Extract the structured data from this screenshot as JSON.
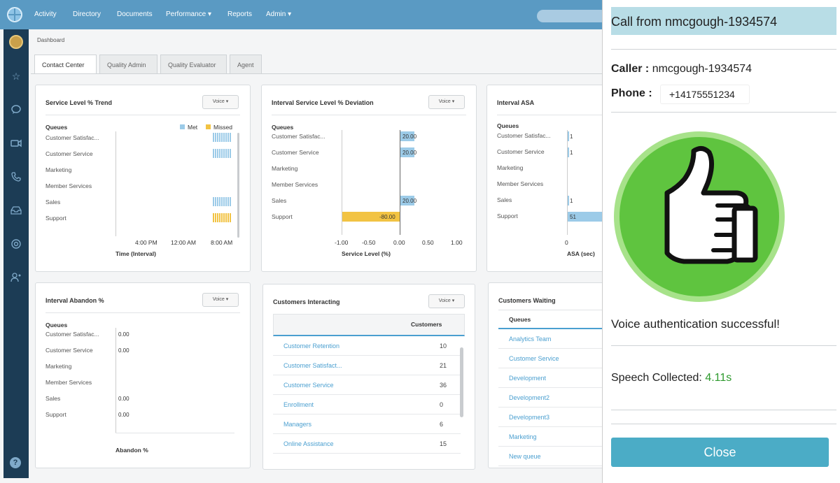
{
  "nav": {
    "items": [
      "Activity",
      "Directory",
      "Documents",
      "Performance ▾",
      "Reports",
      "Admin ▾"
    ]
  },
  "breadcrumb": "Dashboard",
  "tabs": [
    "Contact Center",
    "Quality Admin",
    "Quality Evaluator",
    "Agent"
  ],
  "voice_label": "Voice ▾",
  "queues_header": "Queues",
  "panels": {
    "service_level_trend": {
      "title": "Service Level % Trend",
      "legend_met": "Met",
      "legend_missed": "Missed",
      "queues": [
        "Customer Satisfac...",
        "Customer Service",
        "Marketing",
        "Member Services",
        "Sales",
        "Support"
      ],
      "x_ticks": [
        "4:00 PM",
        "12:00 AM",
        "8:00 AM"
      ],
      "xlabel": "Time (Interval)"
    },
    "interval_deviation": {
      "title": "Interval Service Level % Deviation",
      "queues": [
        "Customer Satisfac...",
        "Customer Service",
        "Marketing",
        "Member Services",
        "Sales",
        "Support"
      ],
      "values": [
        "20.00",
        "20.00",
        "",
        "",
        "20.00",
        "-80.00"
      ],
      "x_ticks": [
        "-1.00",
        "-0.50",
        "0.00",
        "0.50",
        "1.00"
      ],
      "xlabel": "Service Level (%)"
    },
    "interval_asa": {
      "title": "Interval ASA",
      "queues": [
        "Customer Satisfac...",
        "Customer Service",
        "Marketing",
        "Member Services",
        "Sales",
        "Support"
      ],
      "values": [
        "1",
        "1",
        "",
        "",
        "1",
        "51"
      ],
      "x_tick": "0",
      "xlabel": "ASA (sec)"
    },
    "interval_abandon": {
      "title": "Interval Abandon %",
      "queues": [
        "Customer Satisfac...",
        "Customer Service",
        "Marketing",
        "Member Services",
        "Sales",
        "Support"
      ],
      "values": [
        "0.00",
        "0.00",
        "",
        "",
        "0.00",
        "0.00"
      ],
      "xlabel": "Abandon %"
    },
    "customers_interacting": {
      "title": "Customers Interacting",
      "col_header": "Customers",
      "rows": [
        {
          "name": "Customer Retention",
          "count": "10"
        },
        {
          "name": "Customer Satisfact...",
          "count": "21"
        },
        {
          "name": "Customer Service",
          "count": "36"
        },
        {
          "name": "Enrollment",
          "count": "0"
        },
        {
          "name": "Managers",
          "count": "6"
        },
        {
          "name": "Online Assistance",
          "count": "15"
        }
      ]
    },
    "customers_waiting": {
      "title": "Customers Waiting",
      "col_header": "Queues",
      "rows": [
        "Analytics Team",
        "Customer Service",
        "Development",
        "Development2",
        "Development3",
        "Marketing",
        "New queue"
      ]
    }
  },
  "chart_data": [
    {
      "type": "bar",
      "title": "Interval Service Level % Deviation",
      "categories": [
        "Customer Satisfac...",
        "Customer Service",
        "Marketing",
        "Member Services",
        "Sales",
        "Support"
      ],
      "values": [
        20.0,
        20.0,
        null,
        null,
        20.0,
        -80.0
      ],
      "xlabel": "Service Level (%)",
      "xlim": [
        -1.0,
        1.0
      ],
      "colors": {
        "positive": "#9ccbe8",
        "negative": "#f2c343"
      }
    },
    {
      "type": "bar",
      "title": "Interval ASA",
      "categories": [
        "Customer Satisfac...",
        "Customer Service",
        "Marketing",
        "Member Services",
        "Sales",
        "Support"
      ],
      "values": [
        1,
        1,
        null,
        null,
        1,
        51
      ],
      "xlabel": "ASA (sec)"
    }
  ],
  "popup": {
    "title": "Call from nmcgough-1934574",
    "caller_label": "Caller :",
    "caller_value": "nmcgough-1934574",
    "phone_label": "Phone :",
    "phone_value": "+14175551234",
    "status": "Voice authentication successful!",
    "speech_label": "Speech Collected:",
    "speech_value": "4.11s",
    "close_label": "Close",
    "colors": {
      "success": "#2e9a2e",
      "thumb_circle": "#5fc43f",
      "button": "#4bacc6"
    }
  }
}
